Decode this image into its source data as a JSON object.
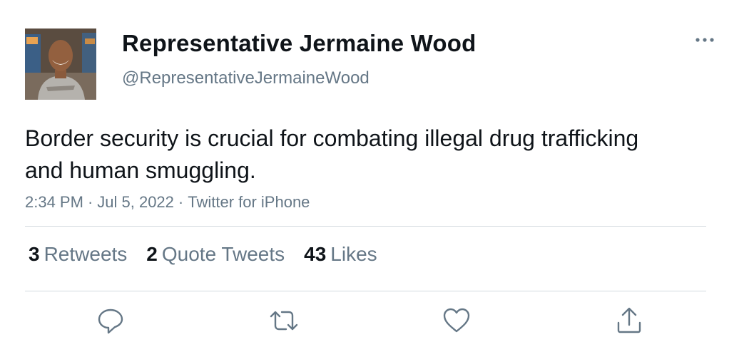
{
  "author": {
    "display_name": "Representative Jermaine Wood",
    "handle": "@RepresentativeJermaineWood"
  },
  "tweet": {
    "text": "Border security is crucial for combating illegal drug trafficking and human smuggling.",
    "time": "2:34 PM",
    "separator": "·",
    "date": "Jul 5, 2022",
    "source": "Twitter for iPhone"
  },
  "stats": {
    "retweets": {
      "count": "3",
      "label": "Retweets"
    },
    "quote_tweets": {
      "count": "2",
      "label": "Quote Tweets"
    },
    "likes": {
      "count": "43",
      "label": "Likes"
    }
  },
  "icons": {
    "more": "more-horizontal-icon",
    "reply": "reply-icon",
    "retweet": "retweet-icon",
    "like": "heart-icon",
    "share": "share-icon"
  },
  "colors": {
    "text_primary": "#0f1419",
    "text_secondary": "#657786",
    "icon": "#657786",
    "divider": "#d3d9de"
  }
}
